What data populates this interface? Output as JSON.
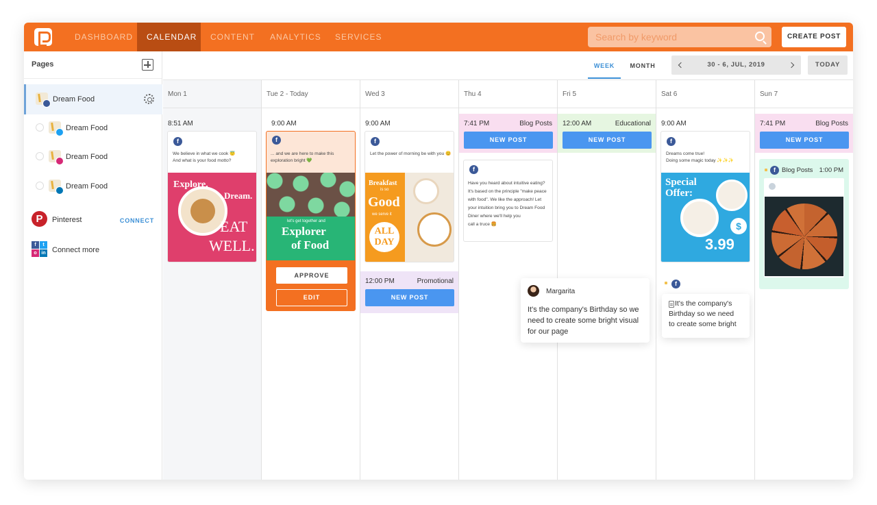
{
  "nav": {
    "items": [
      "DASHBOARD",
      "CALENDAR",
      "CONTENT",
      "ANALYTICS",
      "SERVICES"
    ],
    "active": "CALENDAR",
    "search_placeholder": "Search by keyword",
    "create_label": "CREATE POST"
  },
  "sidebar": {
    "title": "Pages",
    "pages": [
      {
        "label": "Dream Food",
        "network": "facebook",
        "color": "#3b5998"
      },
      {
        "label": "Dream Food",
        "network": "twitter",
        "color": "#1da1f2"
      },
      {
        "label": "Dream Food",
        "network": "instagram",
        "color": "#d62976"
      },
      {
        "label": "Dream Food",
        "network": "linkedin",
        "color": "#0077b5"
      }
    ],
    "pinterest_label": "Pinterest",
    "connect_label": "CONNECT",
    "connect_more_label": "Connect more"
  },
  "toolbar": {
    "week_label": "WEEK",
    "month_label": "MONTH",
    "date_range": "30 - 6, JUL, 2019",
    "today_label": "TODAY"
  },
  "days": [
    "Mon 1",
    "Tue 2 - Today",
    "Wed 3",
    "Thu 4",
    "Fri 5",
    "Sat 6",
    "Sun 7"
  ],
  "posts": {
    "mon": {
      "time": "8:51 AM",
      "caption_1": "We believe in what we cook 😇",
      "caption_2": "And what is your food motto?",
      "img_l1": "Explore.",
      "img_l2": "Dream.",
      "img_l3": "EAT",
      "img_l4": "WELL."
    },
    "tue": {
      "time": "9:00 AM",
      "caption_1": "... and we are here to make this",
      "caption_2": "exploration bright 💚",
      "img_small": "let's get together and",
      "img_l1": "Explorer",
      "img_l2": "of Food",
      "approve_label": "APPROVE",
      "edit_label": "EDIT"
    },
    "wed": {
      "time": "9:00 AM",
      "caption": "Let the power of morning be with you 😊",
      "img_l1": "Breakfast",
      "img_l2": "is so",
      "img_l3": "Good",
      "img_l4": "we serve it",
      "img_l5": "ALL",
      "img_l6": "DAY",
      "slot2_time": "12:00 PM",
      "slot2_kind": "Promotional",
      "newpost_label": "NEW POST"
    },
    "thu": {
      "time": "7:41 PM",
      "kind": "Blog Posts",
      "newpost_label": "NEW POST",
      "caption_1": "Have you heard about intuitive eating?",
      "caption_2": "It's based on the principle \"make peace",
      "caption_3": "with food\". We like the approach! Let",
      "caption_4": "your intuition bring you to Dream Food",
      "caption_5": "Diner where we'll help you",
      "caption_6": "call a truce 🍔"
    },
    "fri": {
      "time": "12:00 AM",
      "kind": "Educational",
      "newpost_label": "NEW POST"
    },
    "sat": {
      "time": "9:00 AM",
      "caption_1": "Dreams come true!",
      "caption_2": "Doing some magic today ✨✨✨",
      "img_l1": "Special",
      "img_l2": "Offer:",
      "img_price": "3.99",
      "img_dollar": "$",
      "note_1": "It's the company's",
      "note_2": "Birthday so we need",
      "note_3": "to create some bright"
    },
    "sun": {
      "time": "7:41 PM",
      "kind": "Blog Posts",
      "newpost_label": "NEW POST",
      "card_kind": "Blog Posts",
      "card_time": "1:00 PM"
    }
  },
  "comment": {
    "author": "Margarita",
    "line_1": "It's the company's Birthday so we",
    "line_2": "need to create some bright visual",
    "line_3": "for our page"
  },
  "colors": {
    "brand": "#f37021",
    "accent": "#4a96f0",
    "facebook": "#3b5998"
  }
}
